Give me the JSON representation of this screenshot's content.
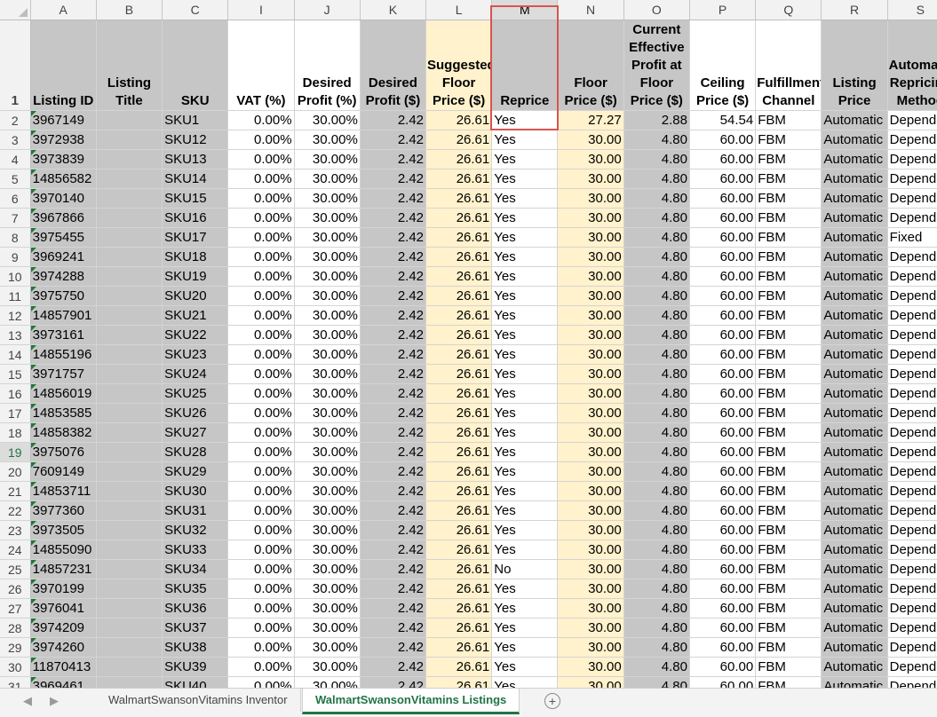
{
  "columns": [
    "A",
    "B",
    "C",
    "I",
    "J",
    "K",
    "L",
    "M",
    "N",
    "O",
    "P",
    "Q",
    "R",
    "S"
  ],
  "selected_column": "M",
  "selected_row": "19",
  "headers": {
    "A": "Listing ID",
    "B": "Listing Title",
    "C": "SKU",
    "I": "VAT (%)",
    "J": "Desired Profit (%)",
    "K": "Desired Profit ($)",
    "L": "Suggested Floor Price ($)",
    "M": "Reprice",
    "N": "Floor Price ($)",
    "O": "Current Effective Profit at Floor Price ($)",
    "P": "Ceiling Price ($)",
    "Q": "Fulfillment Channel",
    "R": "Listing Price",
    "S": "Automatic Repricing Method"
  },
  "rows": [
    {
      "n": "2",
      "id": "3967149",
      "sku": "SKU1",
      "vat": "0.00%",
      "dp": "30.00%",
      "dpd": "2.42",
      "sfp": "26.61",
      "rep": "Yes",
      "fp": "27.27",
      "cep": "2.88",
      "cp": "54.54",
      "fc": "FBM",
      "lp": "Automatic",
      "arm": "Dependant"
    },
    {
      "n": "3",
      "id": "3972938",
      "sku": "SKU12",
      "vat": "0.00%",
      "dp": "30.00%",
      "dpd": "2.42",
      "sfp": "26.61",
      "rep": "Yes",
      "fp": "30.00",
      "cep": "4.80",
      "cp": "60.00",
      "fc": "FBM",
      "lp": "Automatic",
      "arm": "Dependant"
    },
    {
      "n": "4",
      "id": "3973839",
      "sku": "SKU13",
      "vat": "0.00%",
      "dp": "30.00%",
      "dpd": "2.42",
      "sfp": "26.61",
      "rep": "Yes",
      "fp": "30.00",
      "cep": "4.80",
      "cp": "60.00",
      "fc": "FBM",
      "lp": "Automatic",
      "arm": "Dependant"
    },
    {
      "n": "5",
      "id": "14856582",
      "sku": "SKU14",
      "vat": "0.00%",
      "dp": "30.00%",
      "dpd": "2.42",
      "sfp": "26.61",
      "rep": "Yes",
      "fp": "30.00",
      "cep": "4.80",
      "cp": "60.00",
      "fc": "FBM",
      "lp": "Automatic",
      "arm": "Dependant"
    },
    {
      "n": "6",
      "id": "3970140",
      "sku": "SKU15",
      "vat": "0.00%",
      "dp": "30.00%",
      "dpd": "2.42",
      "sfp": "26.61",
      "rep": "Yes",
      "fp": "30.00",
      "cep": "4.80",
      "cp": "60.00",
      "fc": "FBM",
      "lp": "Automatic",
      "arm": "Dependant"
    },
    {
      "n": "7",
      "id": "3967866",
      "sku": "SKU16",
      "vat": "0.00%",
      "dp": "30.00%",
      "dpd": "2.42",
      "sfp": "26.61",
      "rep": "Yes",
      "fp": "30.00",
      "cep": "4.80",
      "cp": "60.00",
      "fc": "FBM",
      "lp": "Automatic",
      "arm": "Dependant"
    },
    {
      "n": "8",
      "id": "3975455",
      "sku": "SKU17",
      "vat": "0.00%",
      "dp": "30.00%",
      "dpd": "2.42",
      "sfp": "26.61",
      "rep": "Yes",
      "fp": "30.00",
      "cep": "4.80",
      "cp": "60.00",
      "fc": "FBM",
      "lp": "Automatic",
      "arm": "Fixed"
    },
    {
      "n": "9",
      "id": "3969241",
      "sku": "SKU18",
      "vat": "0.00%",
      "dp": "30.00%",
      "dpd": "2.42",
      "sfp": "26.61",
      "rep": "Yes",
      "fp": "30.00",
      "cep": "4.80",
      "cp": "60.00",
      "fc": "FBM",
      "lp": "Automatic",
      "arm": "Dependant"
    },
    {
      "n": "10",
      "id": "3974288",
      "sku": "SKU19",
      "vat": "0.00%",
      "dp": "30.00%",
      "dpd": "2.42",
      "sfp": "26.61",
      "rep": "Yes",
      "fp": "30.00",
      "cep": "4.80",
      "cp": "60.00",
      "fc": "FBM",
      "lp": "Automatic",
      "arm": "Dependant"
    },
    {
      "n": "11",
      "id": "3975750",
      "sku": "SKU20",
      "vat": "0.00%",
      "dp": "30.00%",
      "dpd": "2.42",
      "sfp": "26.61",
      "rep": "Yes",
      "fp": "30.00",
      "cep": "4.80",
      "cp": "60.00",
      "fc": "FBM",
      "lp": "Automatic",
      "arm": "Dependant"
    },
    {
      "n": "12",
      "id": "14857901",
      "sku": "SKU21",
      "vat": "0.00%",
      "dp": "30.00%",
      "dpd": "2.42",
      "sfp": "26.61",
      "rep": "Yes",
      "fp": "30.00",
      "cep": "4.80",
      "cp": "60.00",
      "fc": "FBM",
      "lp": "Automatic",
      "arm": "Dependant"
    },
    {
      "n": "13",
      "id": "3973161",
      "sku": "SKU22",
      "vat": "0.00%",
      "dp": "30.00%",
      "dpd": "2.42",
      "sfp": "26.61",
      "rep": "Yes",
      "fp": "30.00",
      "cep": "4.80",
      "cp": "60.00",
      "fc": "FBM",
      "lp": "Automatic",
      "arm": "Dependant"
    },
    {
      "n": "14",
      "id": "14855196",
      "sku": "SKU23",
      "vat": "0.00%",
      "dp": "30.00%",
      "dpd": "2.42",
      "sfp": "26.61",
      "rep": "Yes",
      "fp": "30.00",
      "cep": "4.80",
      "cp": "60.00",
      "fc": "FBM",
      "lp": "Automatic",
      "arm": "Dependant"
    },
    {
      "n": "15",
      "id": "3971757",
      "sku": "SKU24",
      "vat": "0.00%",
      "dp": "30.00%",
      "dpd": "2.42",
      "sfp": "26.61",
      "rep": "Yes",
      "fp": "30.00",
      "cep": "4.80",
      "cp": "60.00",
      "fc": "FBM",
      "lp": "Automatic",
      "arm": "Dependant"
    },
    {
      "n": "16",
      "id": "14856019",
      "sku": "SKU25",
      "vat": "0.00%",
      "dp": "30.00%",
      "dpd": "2.42",
      "sfp": "26.61",
      "rep": "Yes",
      "fp": "30.00",
      "cep": "4.80",
      "cp": "60.00",
      "fc": "FBM",
      "lp": "Automatic",
      "arm": "Dependant"
    },
    {
      "n": "17",
      "id": "14853585",
      "sku": "SKU26",
      "vat": "0.00%",
      "dp": "30.00%",
      "dpd": "2.42",
      "sfp": "26.61",
      "rep": "Yes",
      "fp": "30.00",
      "cep": "4.80",
      "cp": "60.00",
      "fc": "FBM",
      "lp": "Automatic",
      "arm": "Dependant"
    },
    {
      "n": "18",
      "id": "14858382",
      "sku": "SKU27",
      "vat": "0.00%",
      "dp": "30.00%",
      "dpd": "2.42",
      "sfp": "26.61",
      "rep": "Yes",
      "fp": "30.00",
      "cep": "4.80",
      "cp": "60.00",
      "fc": "FBM",
      "lp": "Automatic",
      "arm": "Dependant"
    },
    {
      "n": "19",
      "id": "3975076",
      "sku": "SKU28",
      "vat": "0.00%",
      "dp": "30.00%",
      "dpd": "2.42",
      "sfp": "26.61",
      "rep": "Yes",
      "fp": "30.00",
      "cep": "4.80",
      "cp": "60.00",
      "fc": "FBM",
      "lp": "Automatic",
      "arm": "Dependant"
    },
    {
      "n": "20",
      "id": "7609149",
      "sku": "SKU29",
      "vat": "0.00%",
      "dp": "30.00%",
      "dpd": "2.42",
      "sfp": "26.61",
      "rep": "Yes",
      "fp": "30.00",
      "cep": "4.80",
      "cp": "60.00",
      "fc": "FBM",
      "lp": "Automatic",
      "arm": "Dependant"
    },
    {
      "n": "21",
      "id": "14853711",
      "sku": "SKU30",
      "vat": "0.00%",
      "dp": "30.00%",
      "dpd": "2.42",
      "sfp": "26.61",
      "rep": "Yes",
      "fp": "30.00",
      "cep": "4.80",
      "cp": "60.00",
      "fc": "FBM",
      "lp": "Automatic",
      "arm": "Dependant"
    },
    {
      "n": "22",
      "id": "3977360",
      "sku": "SKU31",
      "vat": "0.00%",
      "dp": "30.00%",
      "dpd": "2.42",
      "sfp": "26.61",
      "rep": "Yes",
      "fp": "30.00",
      "cep": "4.80",
      "cp": "60.00",
      "fc": "FBM",
      "lp": "Automatic",
      "arm": "Dependant"
    },
    {
      "n": "23",
      "id": "3973505",
      "sku": "SKU32",
      "vat": "0.00%",
      "dp": "30.00%",
      "dpd": "2.42",
      "sfp": "26.61",
      "rep": "Yes",
      "fp": "30.00",
      "cep": "4.80",
      "cp": "60.00",
      "fc": "FBM",
      "lp": "Automatic",
      "arm": "Dependant"
    },
    {
      "n": "24",
      "id": "14855090",
      "sku": "SKU33",
      "vat": "0.00%",
      "dp": "30.00%",
      "dpd": "2.42",
      "sfp": "26.61",
      "rep": "Yes",
      "fp": "30.00",
      "cep": "4.80",
      "cp": "60.00",
      "fc": "FBM",
      "lp": "Automatic",
      "arm": "Dependant"
    },
    {
      "n": "25",
      "id": "14857231",
      "sku": "SKU34",
      "vat": "0.00%",
      "dp": "30.00%",
      "dpd": "2.42",
      "sfp": "26.61",
      "rep": "No",
      "fp": "30.00",
      "cep": "4.80",
      "cp": "60.00",
      "fc": "FBM",
      "lp": "Automatic",
      "arm": "Dependant"
    },
    {
      "n": "26",
      "id": "3970199",
      "sku": "SKU35",
      "vat": "0.00%",
      "dp": "30.00%",
      "dpd": "2.42",
      "sfp": "26.61",
      "rep": "Yes",
      "fp": "30.00",
      "cep": "4.80",
      "cp": "60.00",
      "fc": "FBM",
      "lp": "Automatic",
      "arm": "Dependant"
    },
    {
      "n": "27",
      "id": "3976041",
      "sku": "SKU36",
      "vat": "0.00%",
      "dp": "30.00%",
      "dpd": "2.42",
      "sfp": "26.61",
      "rep": "Yes",
      "fp": "30.00",
      "cep": "4.80",
      "cp": "60.00",
      "fc": "FBM",
      "lp": "Automatic",
      "arm": "Dependant"
    },
    {
      "n": "28",
      "id": "3974209",
      "sku": "SKU37",
      "vat": "0.00%",
      "dp": "30.00%",
      "dpd": "2.42",
      "sfp": "26.61",
      "rep": "Yes",
      "fp": "30.00",
      "cep": "4.80",
      "cp": "60.00",
      "fc": "FBM",
      "lp": "Automatic",
      "arm": "Dependant"
    },
    {
      "n": "29",
      "id": "3974260",
      "sku": "SKU38",
      "vat": "0.00%",
      "dp": "30.00%",
      "dpd": "2.42",
      "sfp": "26.61",
      "rep": "Yes",
      "fp": "30.00",
      "cep": "4.80",
      "cp": "60.00",
      "fc": "FBM",
      "lp": "Automatic",
      "arm": "Dependant"
    },
    {
      "n": "30",
      "id": "11870413",
      "sku": "SKU39",
      "vat": "0.00%",
      "dp": "30.00%",
      "dpd": "2.42",
      "sfp": "26.61",
      "rep": "Yes",
      "fp": "30.00",
      "cep": "4.80",
      "cp": "60.00",
      "fc": "FBM",
      "lp": "Automatic",
      "arm": "Dependant"
    },
    {
      "n": "31",
      "id": "3969461",
      "sku": "SKU40",
      "vat": "0.00%",
      "dp": "30.00%",
      "dpd": "2.42",
      "sfp": "26.61",
      "rep": "Yes",
      "fp": "30.00",
      "cep": "4.80",
      "cp": "60.00",
      "fc": "FBM",
      "lp": "Automatic",
      "arm": "Dependant"
    }
  ],
  "sheet_tabs": [
    {
      "label": "WalmartSwansonVitamins Inventor",
      "active": false
    },
    {
      "label": "WalmartSwansonVitamins Listings",
      "active": true
    }
  ],
  "add_sheet_label": "+",
  "nav_prev": "◀",
  "nav_next": "▶",
  "colors": {
    "accent": "#217346",
    "gray_fill": "#c6c6c6",
    "yellow_fill": "#fff2cc",
    "highlight_box": "#d9534f"
  }
}
